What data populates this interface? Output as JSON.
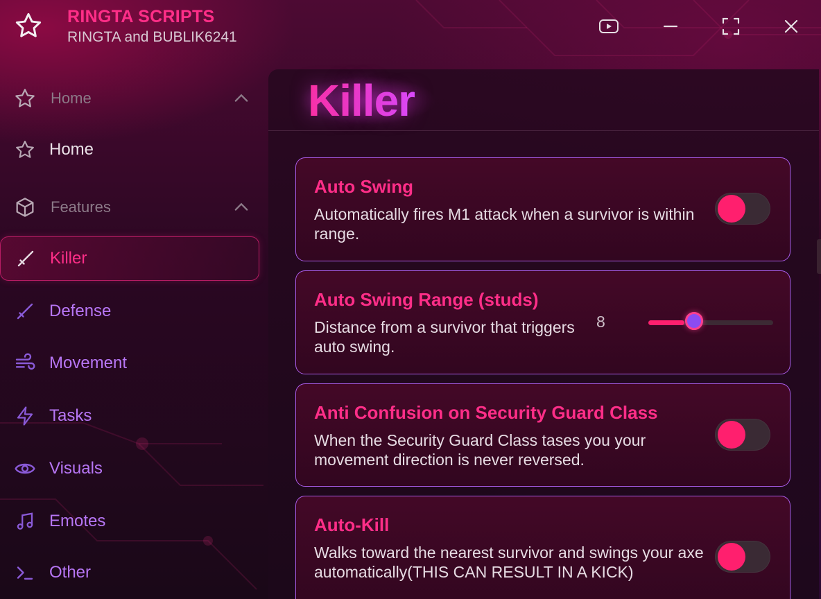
{
  "brand": {
    "title": "RINGTA SCRIPTS",
    "subtitle": "RINGTA and BUBLIK6241"
  },
  "window_controls": [
    "play-icon",
    "minimize-icon",
    "fullscreen-icon",
    "close-icon"
  ],
  "sidebar": {
    "sections": [
      {
        "label": "Home",
        "icon": "star-icon",
        "expanded": true,
        "items": [
          {
            "label": "Home",
            "icon": "star-icon"
          }
        ]
      },
      {
        "label": "Features",
        "icon": "cube-icon",
        "expanded": true,
        "items": [
          {
            "label": "Killer",
            "icon": "sword-icon",
            "active": true
          },
          {
            "label": "Defense",
            "icon": "sword-icon"
          },
          {
            "label": "Movement",
            "icon": "wind-icon"
          },
          {
            "label": "Tasks",
            "icon": "lightning-icon"
          },
          {
            "label": "Visuals",
            "icon": "eye-icon"
          },
          {
            "label": "Emotes",
            "icon": "music-note-icon"
          },
          {
            "label": "Other",
            "icon": "terminal-icon"
          }
        ]
      }
    ]
  },
  "main": {
    "title": "Killer",
    "cards": [
      {
        "title": "Auto Swing",
        "description": "Automatically fires M1 attack when a survivor is within range.",
        "control": "toggle",
        "enabled": false
      },
      {
        "title": "Auto Swing Range (studs)",
        "description": "Distance from a survivor that triggers auto swing.",
        "control": "slider",
        "value": "8",
        "fill_fraction": 0.29
      },
      {
        "title": "Anti Confusion on Security Guard Class",
        "description": "When the Security Guard Class tases you your movement direction is never reversed.",
        "control": "toggle",
        "enabled": false
      },
      {
        "title": "Auto-Kill",
        "description": "Walks toward the nearest survivor and swings your axe automatically(THIS CAN RESULT IN A KICK)",
        "control": "toggle",
        "enabled": false
      }
    ]
  },
  "colors": {
    "accent_pink": "#ff2e88",
    "accent_purple": "#b776f5",
    "card_border": "#a95ce8",
    "toggle_knob": "#ff1f6e"
  }
}
